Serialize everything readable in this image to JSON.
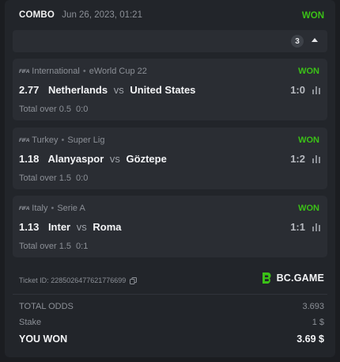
{
  "header": {
    "type": "COMBO",
    "date": "Jun 26, 2023, 01:21",
    "status": "WON"
  },
  "selections_count": "3",
  "bets": [
    {
      "country": "International",
      "league": "eWorld Cup 22",
      "status": "WON",
      "odds": "2.77",
      "home": "Netherlands",
      "vs": "vs",
      "away": "United States",
      "score": "1:0",
      "market": "Total over 0.5",
      "pick": "0:0"
    },
    {
      "country": "Turkey",
      "league": "Super Lig",
      "status": "WON",
      "odds": "1.18",
      "home": "Alanyaspor",
      "vs": "vs",
      "away": "Göztepe",
      "score": "1:2",
      "market": "Total over 1.5",
      "pick": "0:0"
    },
    {
      "country": "Italy",
      "league": "Serie A",
      "status": "WON",
      "odds": "1.13",
      "home": "Inter",
      "vs": "vs",
      "away": "Roma",
      "score": "1:1",
      "market": "Total over 1.5",
      "pick": "0:1"
    }
  ],
  "sport_icon_text": "FIFA",
  "ticket": {
    "label": "Ticket ID:",
    "id": "2285026477621776699"
  },
  "brand": {
    "name": "BC.GAME",
    "color": "#3bc117"
  },
  "summary": {
    "total_odds_label": "TOTAL ODDS",
    "total_odds": "3.693",
    "stake_label": "Stake",
    "stake": "1 $",
    "won_label": "YOU WON",
    "won": "3.69 $"
  },
  "colors": {
    "win": "#3bc117",
    "background": "#1b1d21",
    "card": "#22252a",
    "panel": "#2a2d33"
  }
}
